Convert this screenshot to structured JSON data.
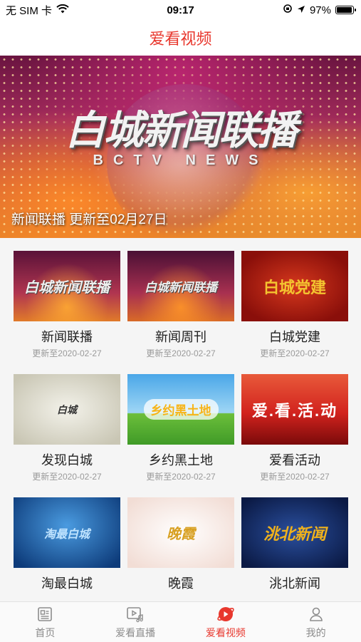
{
  "status_bar": {
    "carrier": "无 SIM 卡",
    "time": "09:17",
    "battery": "97%",
    "battery_level": 0.97
  },
  "header": {
    "title": "爱看视频"
  },
  "banner": {
    "image_title": "白城新闻联播",
    "image_subtitle": "BCTV NEWS",
    "caption": "新闻联播 更新至02月27日"
  },
  "programs": [
    {
      "title": "新闻联播",
      "date": "更新至2020-02-27",
      "thumb_text": "白城新闻联播"
    },
    {
      "title": "新闻周刊",
      "date": "更新至2020-02-27",
      "thumb_text": "白城新闻联播"
    },
    {
      "title": "白城党建",
      "date": "更新至2020-02-27",
      "thumb_text": "白城党建"
    },
    {
      "title": "发现白城",
      "date": "更新至2020-02-27",
      "thumb_text": "白城"
    },
    {
      "title": "乡约黑土地",
      "date": "更新至2020-02-27",
      "thumb_text": "乡约黑土地"
    },
    {
      "title": "爱看活动",
      "date": "更新至2020-02-27",
      "thumb_text": "爱.看.活.动"
    },
    {
      "title": "淘最白城",
      "date": "",
      "thumb_text": "淘最白城"
    },
    {
      "title": "晚霞",
      "date": "",
      "thumb_text": "晚霞"
    },
    {
      "title": "洮北新闻",
      "date": "",
      "thumb_text": "洮北新闻"
    }
  ],
  "tabs": [
    {
      "label": "首页",
      "icon": "home-icon"
    },
    {
      "label": "爱看直播",
      "icon": "live-icon"
    },
    {
      "label": "爱看视频",
      "icon": "video-icon",
      "active": true
    },
    {
      "label": "我的",
      "icon": "profile-icon"
    }
  ],
  "colors": {
    "accent": "#e8372d",
    "inactive": "#8c8c8c"
  }
}
